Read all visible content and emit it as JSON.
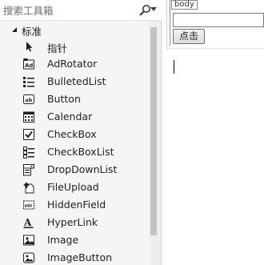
{
  "toolbox": {
    "search_placeholder": "搜索工具箱",
    "group_label": "标准",
    "items": [
      {
        "label": "指针",
        "icon": "pointer-icon"
      },
      {
        "label": "AdRotator",
        "icon": "adrotator-icon"
      },
      {
        "label": "BulletedList",
        "icon": "bulletedlist-icon"
      },
      {
        "label": "Button",
        "icon": "button-icon"
      },
      {
        "label": "Calendar",
        "icon": "calendar-icon"
      },
      {
        "label": "CheckBox",
        "icon": "checkbox-icon"
      },
      {
        "label": "CheckBoxList",
        "icon": "checkboxlist-icon"
      },
      {
        "label": "DropDownList",
        "icon": "dropdownlist-icon"
      },
      {
        "label": "FileUpload",
        "icon": "fileupload-icon"
      },
      {
        "label": "HiddenField",
        "icon": "hiddenfield-icon"
      },
      {
        "label": "HyperLink",
        "icon": "hyperlink-icon"
      },
      {
        "label": "Image",
        "icon": "image-icon"
      },
      {
        "label": "ImageButton",
        "icon": "imagebutton-icon"
      }
    ]
  },
  "design": {
    "body_tag": "body",
    "textbox_value": "",
    "button_label": "点击"
  },
  "colors": {
    "panel_bg": "#f5f5f5",
    "text": "#1e1e1e",
    "scroll_thumb": "#c2c2c2"
  }
}
